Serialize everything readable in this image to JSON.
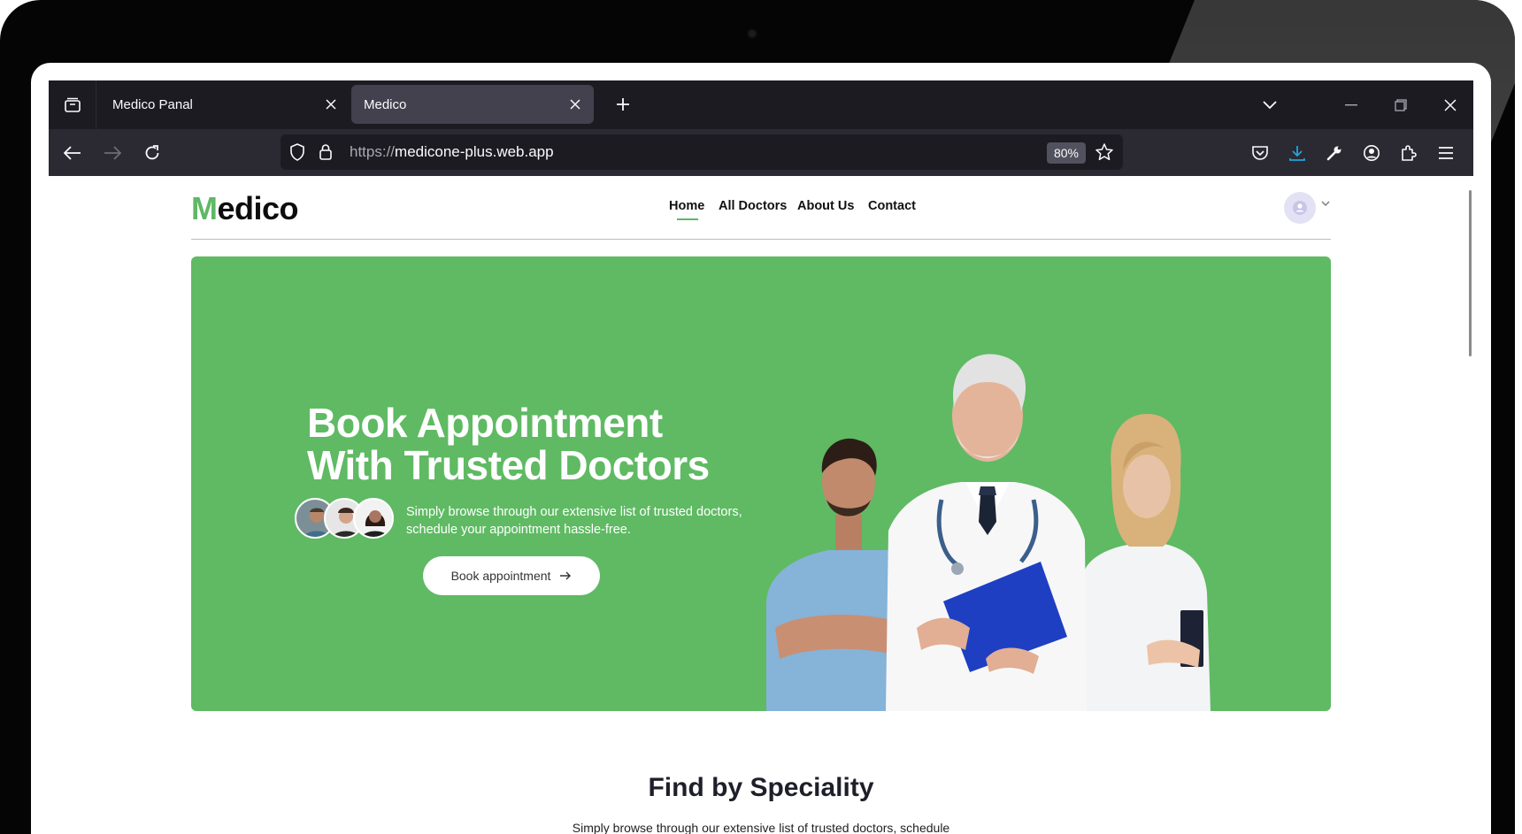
{
  "browser": {
    "tabs": [
      {
        "title": "Medico Panal",
        "active": false
      },
      {
        "title": "Medico",
        "active": true
      }
    ],
    "url_protocol": "https://",
    "url_host": "medicone-plus.web.app",
    "zoom": "80%"
  },
  "site": {
    "logo_first": "M",
    "logo_rest": "edico",
    "nav": [
      "Home",
      "All Doctors",
      "About Us",
      "Contact"
    ],
    "active_nav": "Home"
  },
  "hero": {
    "title_line1": "Book Appointment",
    "title_line2": "With Trusted Doctors",
    "subtitle_line1": "Simply browse through our extensive list of trusted doctors,",
    "subtitle_line2": "schedule your appointment hassle-free.",
    "button_label": "Book appointment"
  },
  "speciality": {
    "title": "Find by Speciality",
    "subtitle": "Simply browse through our extensive list of trusted doctors, schedule"
  },
  "colors": {
    "brand_green": "#5fba63",
    "logo_green": "#5fb865",
    "browser_dark": "#1c1b22",
    "download_blue": "#21a3db"
  }
}
